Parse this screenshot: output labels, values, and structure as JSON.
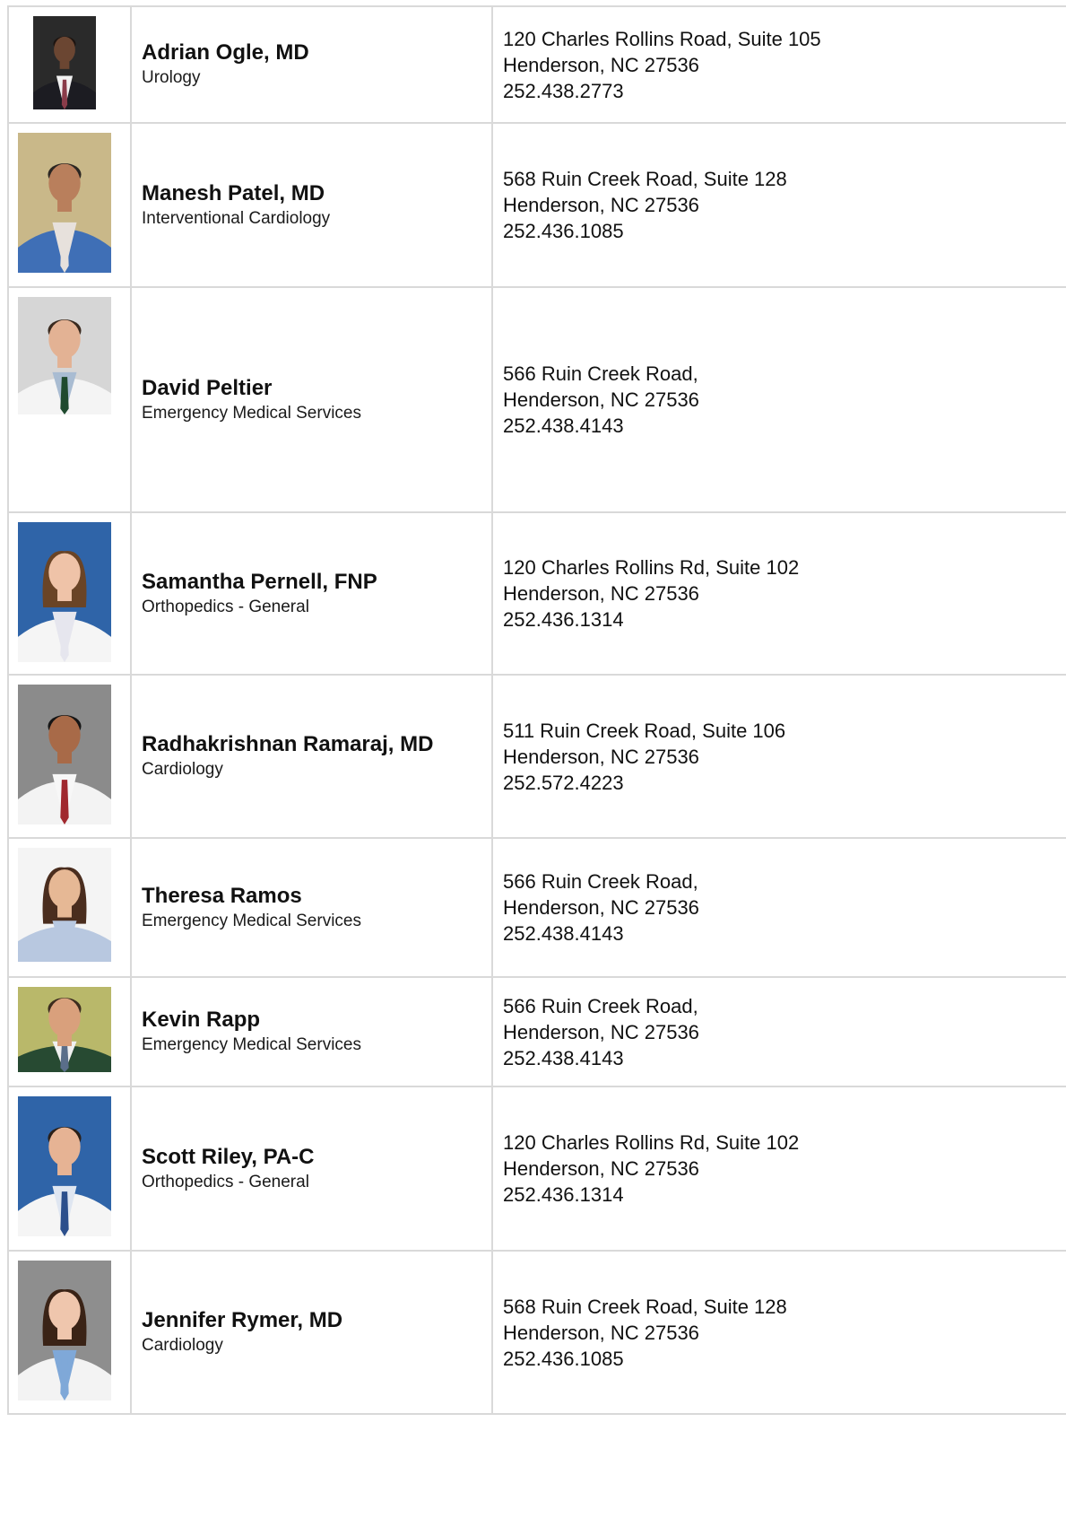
{
  "providers": [
    {
      "name": "Adrian Ogle, MD",
      "specialty": "Urology",
      "address1": "120 Charles Rollins Road, Suite 105",
      "address2": "Henderson, NC 27536",
      "phone": "252.438.2773",
      "photo": {
        "bg": "#2a2a2a",
        "skin": "#6b4632",
        "hair": "#1d1410",
        "coat": "#1c1c22",
        "shirt": "#f2f2f2",
        "tie": "#8a3c4a"
      }
    },
    {
      "name": "Manesh Patel, MD",
      "specialty": "Interventional Cardiology",
      "address1": "568 Ruin Creek Road, Suite 128",
      "address2": "Henderson, NC 27536",
      "phone": "252.436.1085",
      "photo": {
        "bg": "#c9b889",
        "skin": "#b97f5c",
        "hair": "#2b2622",
        "coat": "#3f6fb6",
        "shirt": "#e7e1dc",
        "tie": "#e7e1dc"
      }
    },
    {
      "name": "David Peltier",
      "specialty": "Emergency Medical Services",
      "address1": "566 Ruin Creek Road,",
      "address2": "Henderson, NC 27536",
      "phone": "252.438.4143",
      "photo": {
        "bg": "#d6d6d6",
        "skin": "#e3b294",
        "hair": "#3a2a1f",
        "coat": "#f4f4f4",
        "shirt": "#a9bcd2",
        "tie": "#1f4a2e"
      }
    },
    {
      "name": "Samantha Pernell, FNP",
      "specialty": "Orthopedics - General",
      "address1": "120 Charles Rollins Rd, Suite 102",
      "address2": "Henderson, NC 27536",
      "phone": "252.436.1314",
      "photo": {
        "bg": "#2f64a8",
        "skin": "#efc3a8",
        "hair": "#6a4426",
        "coat": "#f5f5f5",
        "shirt": "#e6e6ee",
        "tie": "#e6e6ee"
      }
    },
    {
      "name": "Radhakrishnan Ramaraj, MD",
      "specialty": "Cardiology",
      "address1": "511 Ruin Creek Road, Suite 106",
      "address2": "Henderson, NC 27536",
      "phone": "252.572.4223",
      "photo": {
        "bg": "#8b8b8b",
        "skin": "#a86a48",
        "hair": "#151515",
        "coat": "#f3f3f3",
        "shirt": "#f7f7f7",
        "tie": "#a0282e"
      }
    },
    {
      "name": "Theresa Ramos",
      "specialty": "Emergency Medical Services",
      "address1": "566 Ruin Creek Road,",
      "address2": "Henderson, NC 27536",
      "phone": "252.438.4143",
      "photo": {
        "bg": "#f4f4f4",
        "skin": "#e6b895",
        "hair": "#4a2d1e",
        "coat": "#b8c8e0",
        "shirt": "#b8c8e0",
        "tie": "#b8c8e0"
      }
    },
    {
      "name": "Kevin Rapp",
      "specialty": "Emergency Medical Services",
      "address1": "566 Ruin Creek Road,",
      "address2": "Henderson, NC 27536",
      "phone": "252.438.4143",
      "photo": {
        "bg": "#b9b86a",
        "skin": "#d9a07c",
        "hair": "#3b2b1e",
        "coat": "#274a32",
        "shirt": "#f0f0f0",
        "tie": "#5a6e8a"
      }
    },
    {
      "name": "Scott Riley, PA-C",
      "specialty": "Orthopedics - General",
      "address1": "120 Charles Rollins Rd, Suite 102",
      "address2": "Henderson, NC 27536",
      "phone": "252.436.1314",
      "photo": {
        "bg": "#2f64a8",
        "skin": "#e6b394",
        "hair": "#2a1f18",
        "coat": "#f5f5f5",
        "shirt": "#dfe6f1",
        "tie": "#2c4f8c"
      }
    },
    {
      "name": "Jennifer Rymer, MD",
      "specialty": "Cardiology",
      "address1": "568 Ruin Creek Road, Suite 128",
      "address2": "Henderson, NC 27536",
      "phone": "252.436.1085",
      "photo": {
        "bg": "#8e8e8e",
        "skin": "#efc6ad",
        "hair": "#3a2316",
        "coat": "#f3f3f3",
        "shirt": "#7fa8d8",
        "tie": "#7fa8d8"
      }
    }
  ]
}
